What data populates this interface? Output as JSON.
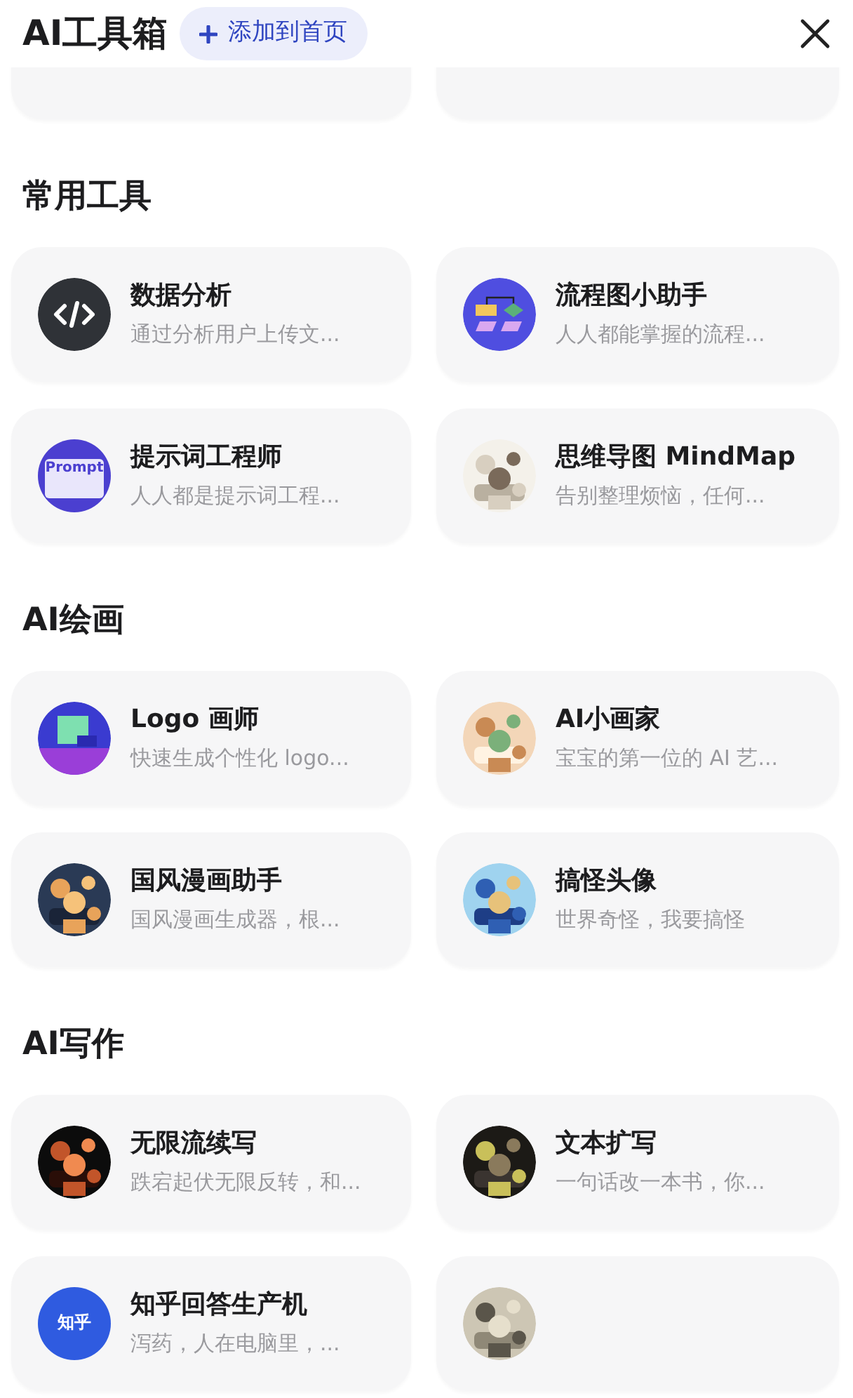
{
  "header": {
    "title": "AI工具箱",
    "add_button": "添加到首页"
  },
  "sections": [
    {
      "tools": [
        {
          "kind": "blank"
        },
        {
          "kind": "blank"
        }
      ]
    },
    {
      "title": "常用工具",
      "tools": [
        {
          "kind": "code",
          "name": "数据分析",
          "description": "通过分析用户上传文..."
        },
        {
          "kind": "flowchart",
          "name": "流程图小助手",
          "description": "人人都能掌握的流程..."
        },
        {
          "kind": "prompt",
          "badge": "Prompt",
          "name": "提示词工程师",
          "description": "人人都是提示词工程..."
        },
        {
          "kind": "picture",
          "name": "思维导图 MindMap",
          "description": "告别整理烦恼，任何..."
        }
      ]
    },
    {
      "title": "AI绘画",
      "tools": [
        {
          "kind": "logo",
          "name": "Logo 画师",
          "description": "快速生成个性化 logo..."
        },
        {
          "kind": "picture",
          "name": "AI小画家",
          "description": "宝宝的第一位的 AI 艺..."
        },
        {
          "kind": "picture",
          "name": "国风漫画助手",
          "description": "国风漫画生成器，根..."
        },
        {
          "kind": "picture",
          "name": "搞怪头像",
          "description": "世界奇怪，我要搞怪"
        }
      ]
    },
    {
      "title": "AI写作",
      "tools": [
        {
          "kind": "picture",
          "name": "无限流续写",
          "description": "跌宕起伏无限反转，和..."
        },
        {
          "kind": "picture",
          "name": "文本扩写",
          "description": "一句话改一本书，你..."
        },
        {
          "kind": "zhihu",
          "badge": "知乎",
          "name": "知乎回答生产机",
          "description": "泻药，人在电脑里，..."
        },
        {
          "kind": "picture"
        }
      ]
    }
  ]
}
